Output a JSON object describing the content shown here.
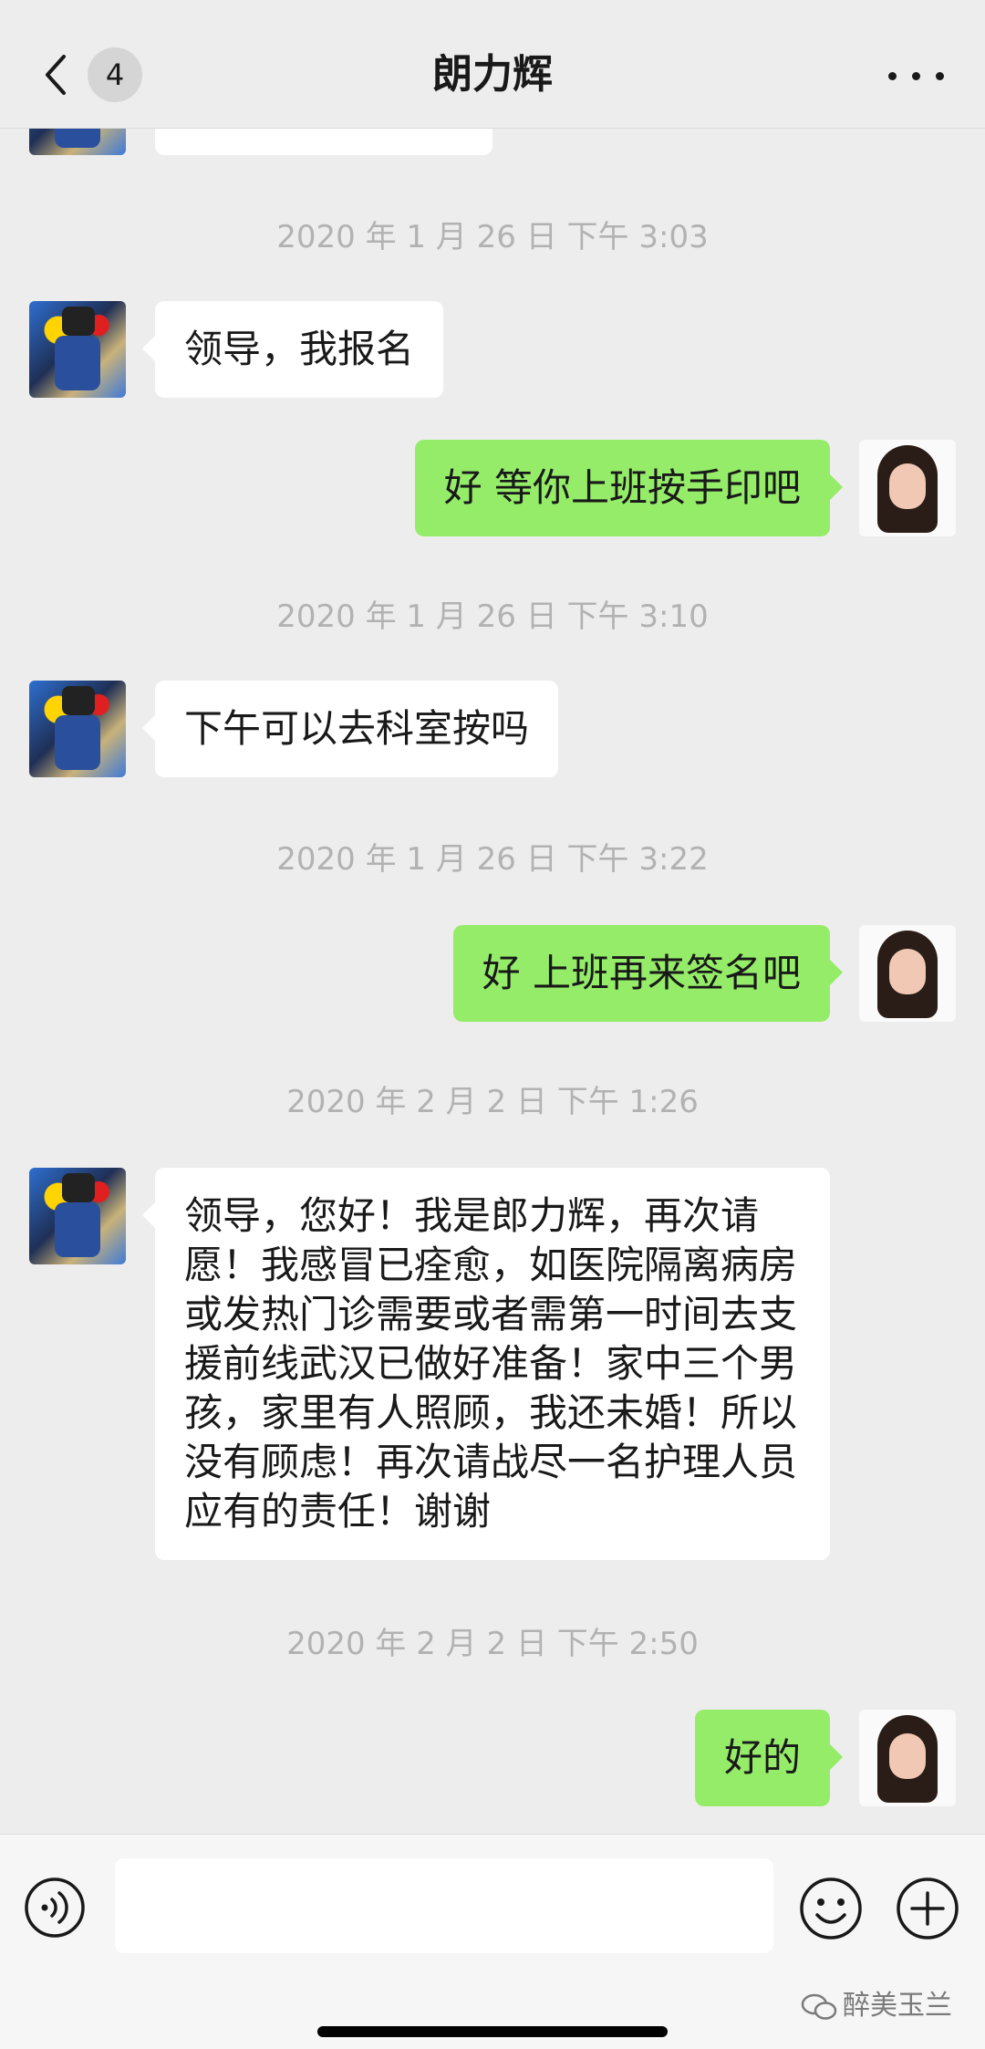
{
  "header": {
    "back_badge_count": "4",
    "title": "朗力辉"
  },
  "conversation": {
    "partial_top_message": "",
    "items": [
      {
        "type": "timestamp",
        "text": "2020 年 1 月 26 日 下午 3:03"
      },
      {
        "type": "message",
        "side": "in",
        "text": "领导，我报名"
      },
      {
        "type": "message",
        "side": "out",
        "text": "好 等你上班按手印吧"
      },
      {
        "type": "timestamp",
        "text": "2020 年 1 月 26 日 下午 3:10"
      },
      {
        "type": "message",
        "side": "in",
        "text": "下午可以去科室按吗"
      },
      {
        "type": "timestamp",
        "text": "2020 年 1 月 26 日 下午 3:22"
      },
      {
        "type": "message",
        "side": "out",
        "text": "好 上班再来签名吧"
      },
      {
        "type": "timestamp",
        "text": "2020 年 2 月 2 日 下午 1:26"
      },
      {
        "type": "message",
        "side": "in",
        "text": "领导，您好！我是郎力辉，再次请愿！我感冒已痊愈，如医院隔离病房或发热门诊需要或者需第一时间去支援前线武汉已做好准备！家中三个男孩，家里有人照顾，我还未婚！所以没有顾虑！再次请战尽一名护理人员应有的责任！谢谢"
      },
      {
        "type": "timestamp",
        "text": "2020 年 2 月 2 日 下午 2:50"
      },
      {
        "type": "message",
        "side": "out",
        "text": "好的"
      }
    ]
  },
  "input_bar": {
    "text_value": "",
    "watermark": "醉美玉兰"
  },
  "icons": {
    "back": "chevron-left-icon",
    "more": "more-dots-icon",
    "voice": "voice-icon",
    "emoji": "emoji-icon",
    "plus": "plus-icon",
    "watermark": "wechat-icon"
  },
  "colors": {
    "background": "#ededed",
    "outgoing_bubble": "#95ec69",
    "incoming_bubble": "#ffffff",
    "timestamp_text": "#b2b2b2"
  }
}
